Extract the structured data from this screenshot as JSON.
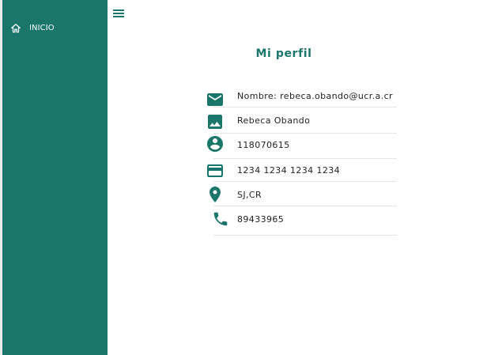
{
  "sidebar": {
    "items": [
      {
        "label": "INICIO",
        "icon": "home-icon"
      }
    ]
  },
  "header": {
    "menu_icon": "menu-icon"
  },
  "profile": {
    "title": "Mi perfil",
    "rows": [
      {
        "icon": "email-icon",
        "text": "Nombre: rebeca.obando@ucr.a.cr"
      },
      {
        "icon": "image-icon",
        "text": "Rebeca Obando"
      },
      {
        "icon": "account-circle-icon",
        "text": "118070615"
      },
      {
        "icon": "credit-card-icon",
        "text": "1234 1234 1234 1234"
      },
      {
        "icon": "location-pin-icon",
        "text": "SJ,CR"
      },
      {
        "icon": "phone-icon",
        "text": "89433965"
      }
    ]
  },
  "colors": {
    "sidebar": "#1a766b",
    "accent": "#1a766b",
    "text": "#222222",
    "divider": "#e6e6e6"
  }
}
